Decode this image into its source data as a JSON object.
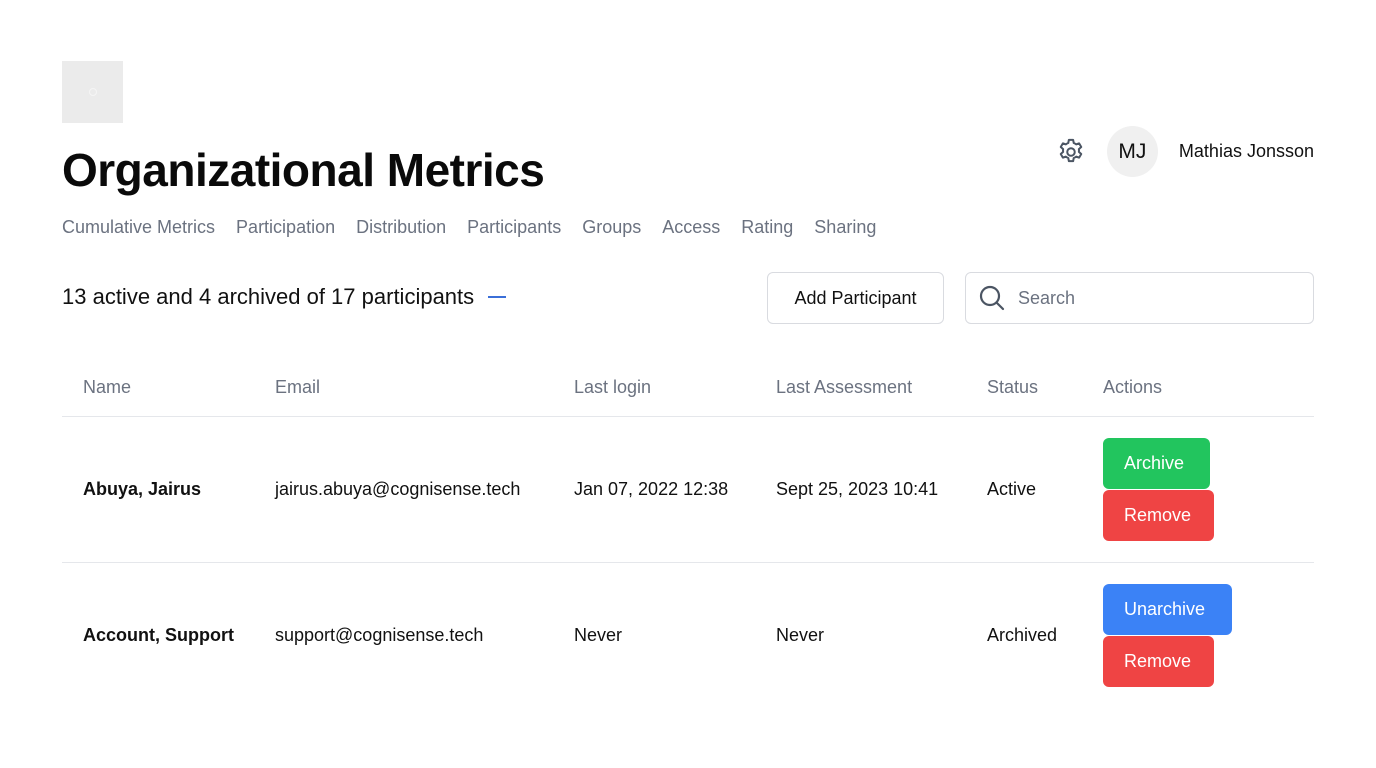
{
  "header": {
    "title": "Organizational Metrics",
    "logo_icon": "placeholder-image-icon"
  },
  "user": {
    "initials": "MJ",
    "name": "Mathias Jonsson",
    "settings_icon": "gear-icon"
  },
  "nav": {
    "tabs": [
      {
        "label": "Cumulative Metrics"
      },
      {
        "label": "Participation"
      },
      {
        "label": "Distribution"
      },
      {
        "label": "Participants"
      },
      {
        "label": "Groups"
      },
      {
        "label": "Access"
      },
      {
        "label": "Rating"
      },
      {
        "label": "Sharing"
      }
    ]
  },
  "summary": {
    "text": "13 active and 4 archived of 17 participants",
    "toggle_icon": "minus-icon"
  },
  "toolbar": {
    "add_label": "Add Participant",
    "search_placeholder": "Search",
    "search_value": "",
    "search_icon": "search-icon"
  },
  "table": {
    "columns": [
      "Name",
      "Email",
      "Last login",
      "Last Assessment",
      "Status",
      "Actions"
    ],
    "rows": [
      {
        "name": "Abuya, Jairus",
        "email": "jairus.abuya@cognisense.tech",
        "last_login": "Jan 07, 2022 12:38",
        "last_assessment": "Sept 25, 2023 10:41",
        "status": "Active",
        "primary_action": "Archive",
        "secondary_action": "Remove"
      },
      {
        "name": "Account, Support",
        "email": "support@cognisense.tech",
        "last_login": "Never",
        "last_assessment": "Never",
        "status": "Archived",
        "primary_action": "Unarchive",
        "secondary_action": "Remove"
      }
    ]
  },
  "colors": {
    "archive": "#22c55e",
    "unarchive": "#3b82f6",
    "remove": "#ef4444",
    "accent": "#3b6fd8",
    "muted_text": "#6b7280"
  }
}
